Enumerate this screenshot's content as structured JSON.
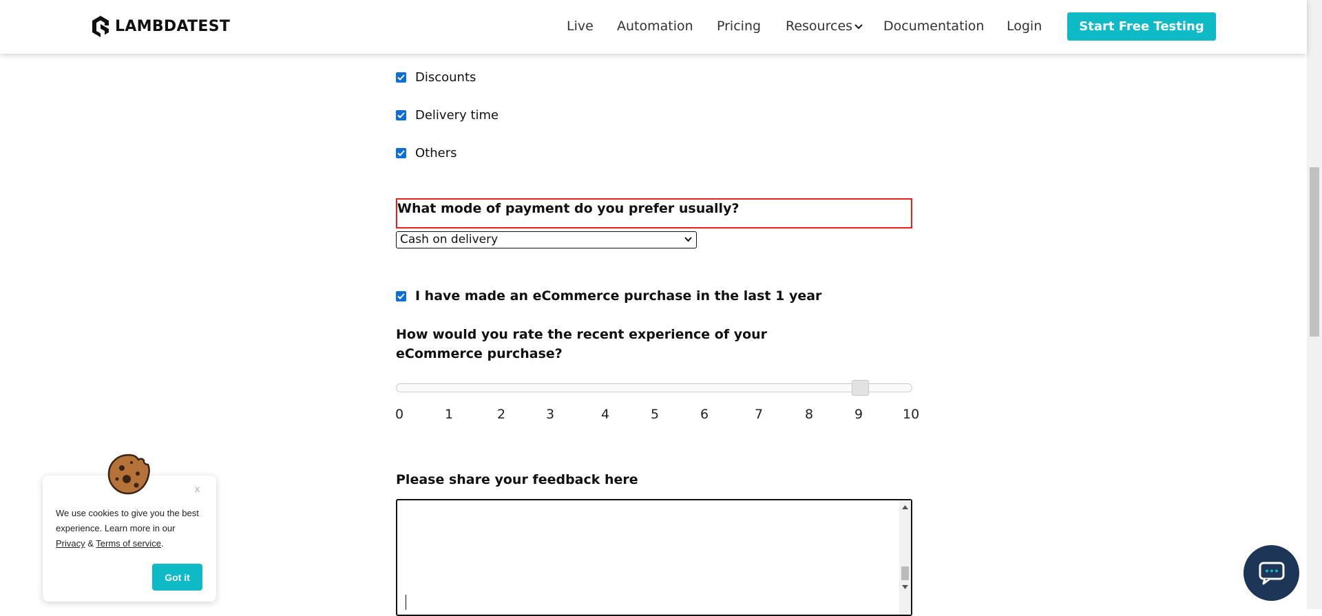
{
  "header": {
    "logo_text": "LAMBDATEST",
    "nav": [
      {
        "label": "Live"
      },
      {
        "label": "Automation"
      },
      {
        "label": "Pricing"
      },
      {
        "label": "Resources"
      },
      {
        "label": "Documentation"
      },
      {
        "label": "Login"
      }
    ],
    "cta_label": "Start Free Testing",
    "accent_color": "#0ebac5"
  },
  "form": {
    "checkboxes": [
      {
        "label": "Discounts",
        "checked": true
      },
      {
        "label": "Delivery time",
        "checked": true
      },
      {
        "label": "Others",
        "checked": true
      }
    ],
    "payment_question": "What mode of payment do you prefer usually?",
    "payment_selected": "Cash on delivery",
    "purchase_confirm": {
      "label": "I have made an eCommerce purchase in the last 1 year",
      "checked": true
    },
    "rating_question": "How would you rate the recent experience of your eCommerce purchase?",
    "rating": {
      "value": 9,
      "min": 0,
      "max": 10,
      "ticks": [
        "0",
        "1",
        "2",
        "3",
        "4",
        "5",
        "6",
        "7",
        "8",
        "9",
        "10"
      ]
    },
    "feedback_label": "Please share your feedback here",
    "feedback_value": ""
  },
  "cookie_banner": {
    "close_label": "x",
    "text_before": "We use cookies to give you the best experience. Learn more in our ",
    "privacy_link": "Privacy",
    "amp": " & ",
    "terms_link": "Terms of service",
    "text_after": ".",
    "button_label": "Got it"
  },
  "icons": [
    "lambdatest-logo-icon",
    "chevron-down-icon",
    "checkbox-checked-icon",
    "select-arrow-icon",
    "cookie-icon",
    "chat-icon"
  ]
}
